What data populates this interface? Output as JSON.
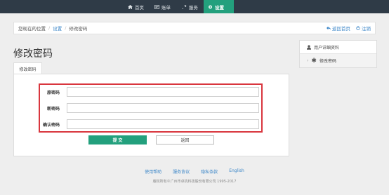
{
  "nav": {
    "items": [
      {
        "label": "首页",
        "icon": "home-icon"
      },
      {
        "label": "账单",
        "icon": "bill-icon"
      },
      {
        "label": "服务",
        "icon": "service-icon"
      },
      {
        "label": "设置",
        "icon": "settings-icon",
        "active": true
      }
    ],
    "accent": "#23a07d",
    "bg": "#2f3b47"
  },
  "breadcrumb": {
    "prefix": "您现在的位置",
    "link": "设置",
    "current": "修改密码",
    "back_home": "返回首页",
    "logout": "注销"
  },
  "page": {
    "title": "修改密码",
    "tab": "修改密码"
  },
  "form": {
    "old_label": "原密码",
    "new_label": "新密码",
    "confirm_label": "确认密码",
    "old_value": "",
    "new_value": "",
    "confirm_value": "",
    "submit": "提 交",
    "back": "返回"
  },
  "sidebar": {
    "items": [
      {
        "label": "用户详细资料",
        "icon": "user-icon"
      },
      {
        "label": "修改密码",
        "icon": "asterisk-icon",
        "active": true
      }
    ]
  },
  "footer": {
    "links": [
      "使用帮助",
      "服务协议",
      "隐私条款",
      "English"
    ],
    "copyright": "版权所有©广州市卓杭科技股份有限公司 1995-2017"
  }
}
